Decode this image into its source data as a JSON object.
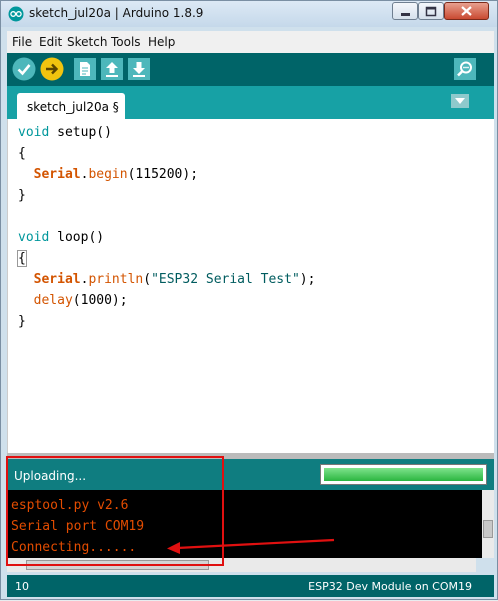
{
  "window": {
    "title": "sketch_jul20a | Arduino 1.8.9"
  },
  "menu": {
    "file": "File",
    "edit": "Edit",
    "sketch": "Sketch",
    "tools": "Tools",
    "help": "Help"
  },
  "toolbar": {
    "icons": [
      "verify-icon",
      "upload-icon",
      "new-icon",
      "open-icon",
      "save-icon",
      "serial-monitor-icon"
    ]
  },
  "tab": {
    "label": "sketch_jul20a §"
  },
  "code": {
    "l1a": "void",
    "l1b": " setup()",
    "l2": "{",
    "l3a": "Serial",
    "l3b": ".",
    "l3c": "begin",
    "l3d": "(115200);",
    "l4": "}",
    "l6a": "void",
    "l6b": " loop()",
    "l7": "{",
    "l8a": "Serial",
    "l8b": ".",
    "l8c": "println",
    "l8d": "(",
    "l8e": "\"ESP32 Serial Test\"",
    "l8f": ");",
    "l9a": "delay",
    "l9b": "(1000);",
    "l10": "}"
  },
  "status": {
    "text": "Uploading...",
    "progress": 1.0
  },
  "console": {
    "lines": [
      "esptool.py v2.6",
      "Serial port COM19",
      "Connecting......"
    ]
  },
  "footer": {
    "line": "10",
    "board": "ESP32 Dev Module on COM19"
  },
  "colors": {
    "teal_dark": "#006468",
    "teal": "#17a1a5",
    "console_text": "#e34c00",
    "annotation": "#e01010"
  }
}
